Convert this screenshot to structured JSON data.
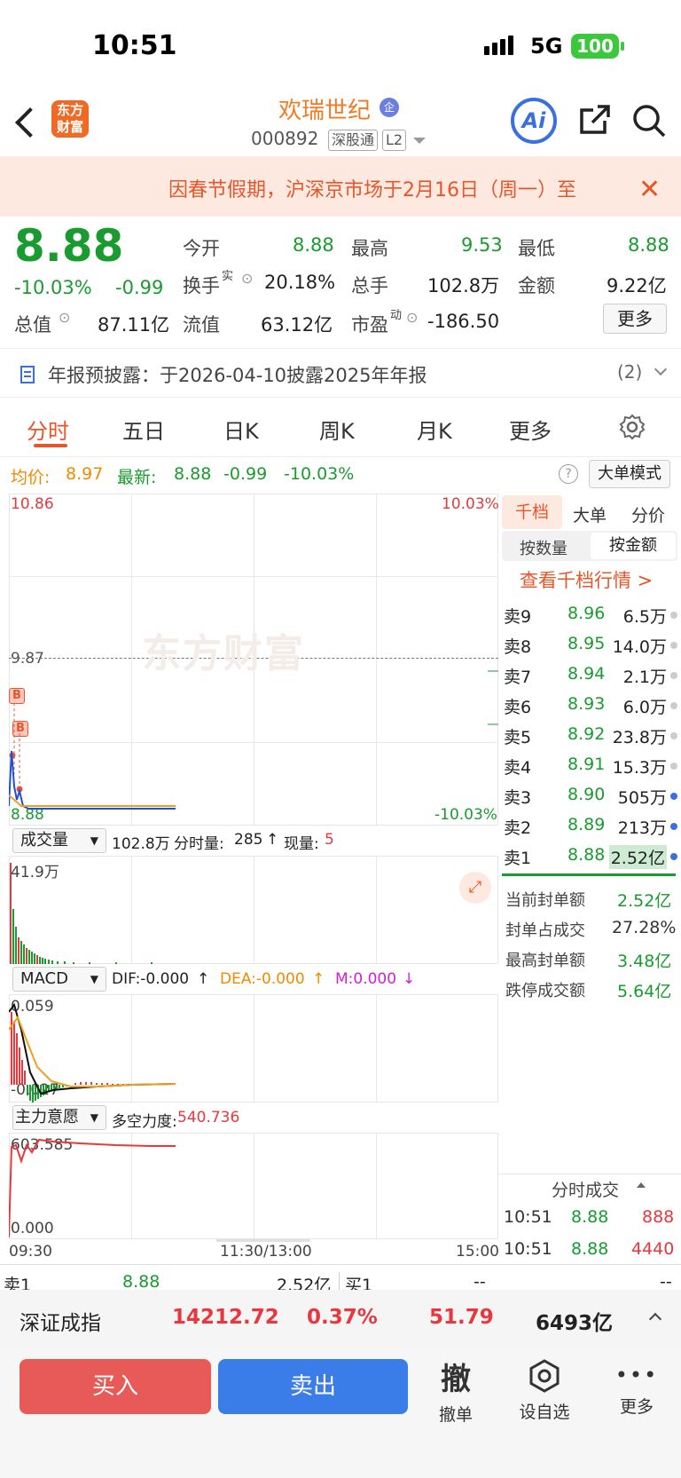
{
  "status": {
    "time": "10:51",
    "network": "5G",
    "battery": "100"
  },
  "header": {
    "logo_line1": "东方",
    "logo_line2": "财富",
    "stock_name": "欢瑞世纪",
    "enterprise_badge": "企",
    "code": "000892",
    "tag1": "深股通",
    "tag2": "L2",
    "ai_label": "Ai",
    "icons": [
      "back-icon",
      "share-icon",
      "search-icon"
    ]
  },
  "notice": {
    "text": "因春节假期，沪深京市场于2月16日（周一）至",
    "close": "✕"
  },
  "quote": {
    "price": "8.88",
    "change_pct": "-10.03%",
    "change": "-0.99",
    "open_label": "今开",
    "open": "8.88",
    "high_label": "最高",
    "high": "9.53",
    "low_label": "最低",
    "low": "8.88",
    "turnover_label": "换手",
    "turnover_sup": "实",
    "turnover": "20.18%",
    "volume_label": "总手",
    "volume": "102.8万",
    "amount_label": "金额",
    "amount": "9.22亿",
    "mktcap_label": "总值",
    "mktcap": "87.11亿",
    "float_label": "流值",
    "float": "63.12亿",
    "pe_label": "市盈",
    "pe_sup": "动",
    "pe": "-186.50",
    "more": "更多"
  },
  "annual": {
    "text": "年报预披露：于2026-04-10披露2025年年报",
    "count": "(2)"
  },
  "tabs": [
    "分时",
    "五日",
    "日K",
    "周K",
    "月K",
    "更多"
  ],
  "infobar": {
    "avg_label": "均价:",
    "avg": "8.97",
    "last_label": "最新:",
    "last": "8.88",
    "chg": "-0.99",
    "pct": "-10.03%",
    "mode": "大单模式"
  },
  "chart": {
    "y_top": "10.86",
    "y_top_pct": "10.03%",
    "y_mid": "9.87",
    "y_bottom": "8.88",
    "y_bottom_pct": "-10.03%",
    "watermark": "东方财富",
    "marker_b": "B",
    "vol_select": "成交量",
    "vol_total": "102.8万",
    "vol_min_label": "分时量:",
    "vol_min": "285",
    "vol_now_label": "现量:",
    "vol_now": "5",
    "vol_max": "41.9万",
    "macd_select": "MACD",
    "dif": "DIF:-0.000",
    "dea": "DEA:-0.000",
    "m": "M:0.000",
    "macd_top": "0.059",
    "macd_bottom": "-0.027",
    "power_select": "主力意愿",
    "power_label": "多空力度:",
    "power": "540.736",
    "power_top": "603.585",
    "power_bottom": "0.000",
    "x_labels": [
      "09:30",
      "11:30/13:00",
      "15:00"
    ]
  },
  "orderbook": {
    "tabs": [
      "千档",
      "大单",
      "分价"
    ],
    "subtabs": [
      "按数量",
      "按金额"
    ],
    "link": "查看千档行情 >",
    "asks": [
      {
        "label": "卖9",
        "price": "8.96",
        "vol": "6.5万"
      },
      {
        "label": "卖8",
        "price": "8.95",
        "vol": "14.0万"
      },
      {
        "label": "卖7",
        "price": "8.94",
        "vol": "2.1万"
      },
      {
        "label": "卖6",
        "price": "8.93",
        "vol": "6.0万"
      },
      {
        "label": "卖5",
        "price": "8.92",
        "vol": "23.8万"
      },
      {
        "label": "卖4",
        "price": "8.91",
        "vol": "15.3万"
      },
      {
        "label": "卖3",
        "price": "8.90",
        "vol": "505万"
      },
      {
        "label": "卖2",
        "price": "8.89",
        "vol": "213万"
      },
      {
        "label": "卖1",
        "price": "8.88",
        "vol": "2.52亿"
      }
    ],
    "stats": [
      {
        "label": "当前封单额",
        "value": "2.52亿"
      },
      {
        "label": "封单占成交",
        "value": "27.28%"
      },
      {
        "label": "最高封单额",
        "value": "3.48亿"
      },
      {
        "label": "跌停成交额",
        "value": "5.64亿"
      }
    ],
    "trades_title": "分时成交",
    "trades": [
      {
        "time": "10:51",
        "price": "8.88",
        "vol": "888"
      },
      {
        "time": "10:51",
        "price": "8.88",
        "vol": "4440"
      }
    ]
  },
  "bottom_quote": {
    "sell1_label": "卖1",
    "sell1_price": "8.88",
    "sell1_vol": "2.52亿",
    "buy1_label": "买1",
    "buy1_price": "--",
    "buy1_vol": "--"
  },
  "index": {
    "name": "深证成指",
    "value": "14212.72",
    "pct": "0.37%",
    "chg": "51.79",
    "amount": "6493亿"
  },
  "actions": {
    "buy": "买入",
    "sell": "卖出",
    "cancel_icon": "撤",
    "cancel": "撤单",
    "watch": "设自选",
    "more": "更多"
  }
}
